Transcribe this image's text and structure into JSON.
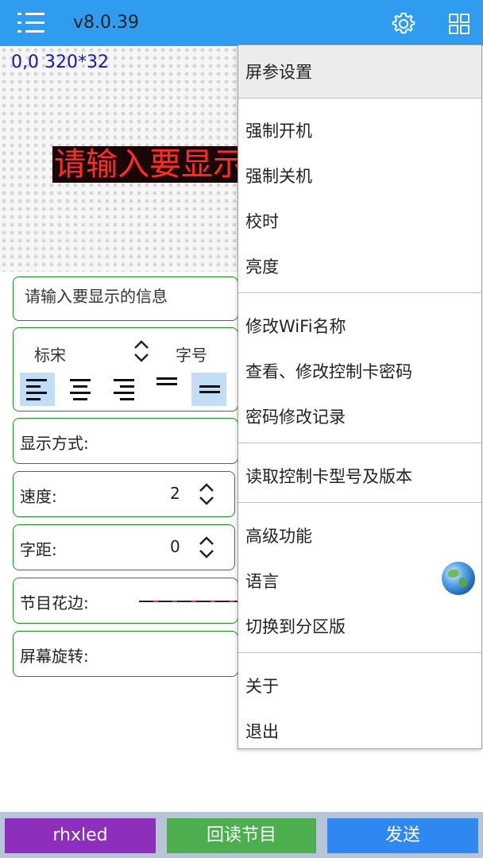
{
  "header": {
    "version": "v8.0.39"
  },
  "preview": {
    "coords": "0,0 320*32",
    "led_text": "请输入要显示的信息"
  },
  "form": {
    "text_placeholder": "请输入要显示的信息",
    "font_name": "标宋",
    "font_size_label": "字号",
    "display_mode_label": "显示方式:",
    "speed_label": "速度:",
    "speed_value": "2",
    "spacing_label": "字距:",
    "spacing_value": "0",
    "border_label": "节目花边:",
    "rotation_label": "屏幕旋转:"
  },
  "bottom": {
    "btn1": "rhxled",
    "btn2": "回读节目",
    "btn3": "发送"
  },
  "menu": {
    "items": [
      "屏参设置",
      "强制开机",
      "强制关机",
      "校时",
      "亮度",
      "修改WiFi名称",
      "查看、修改控制卡密码",
      "密码修改记录",
      "读取控制卡型号及版本",
      "高级功能",
      "语言",
      "切换到分区版",
      "关于",
      "退出"
    ]
  },
  "colors": {
    "topbar": "#2f9cf0",
    "card_border": "#1e8b1e",
    "btn_purple": "#8e2ebd",
    "btn_green": "#4cae4f",
    "btn_blue": "#2f88f0"
  },
  "icons": {
    "menu": "menu-icon",
    "settings": "gear-icon",
    "grid": "grid-icon",
    "language": "globe-icon"
  }
}
